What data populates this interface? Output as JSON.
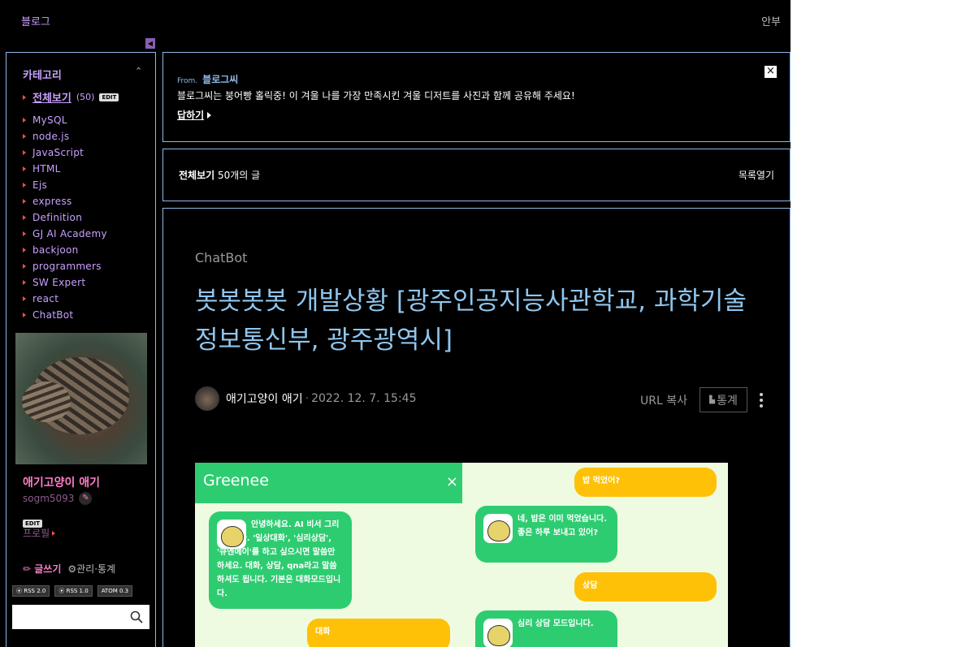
{
  "topbar": {
    "blog_title": "블로그",
    "right_label": "안부"
  },
  "sidebar": {
    "category_header": "카테고리",
    "category_toggle": "⌃",
    "all": {
      "label": "전체보기",
      "count": "(50)",
      "edit": "EDIT"
    },
    "categories": [
      "MySQL",
      "node.js",
      "JavaScript",
      "HTML",
      "Ejs",
      "express",
      "Definition",
      "GJ AI Academy",
      "backjoon",
      "programmers",
      "SW Expert",
      "react",
      "ChatBot"
    ],
    "profile": {
      "name": "애기고양이 애기",
      "id": "sogm5093",
      "edit": "EDIT",
      "link": "프로필"
    },
    "write_label": "글쓰기",
    "admin_label": "관리·통계",
    "rss": [
      "RSS 2.0",
      "RSS 1.0",
      "ATOM 0.3"
    ]
  },
  "notice": {
    "from_prefix": "From.",
    "from_source": "블로그씨",
    "text": "블로그씨는 붕어빵 홀릭중! 이 겨울 나를 가장 만족시킨 겨울 디저트를 사진과 함께 공유해 주세요!",
    "reply": "답하기",
    "close": "×"
  },
  "listbar": {
    "title": "전체보기",
    "count_text": "50개의 글",
    "open": "목록열기"
  },
  "article": {
    "category": "ChatBot",
    "title": "봇봇봇봇 개발상황 [광주인공지능사관학교, 과학기술정보통신부, 광주광역시]",
    "author": "애기고양이 애기",
    "date": "2022. 12. 7. 15:45",
    "url_copy": "URL 복사",
    "stats": "통계"
  },
  "chat_image": {
    "bot_name": "Greenee",
    "close": "×",
    "messages": [
      {
        "from": "bot",
        "text": "안녕하세요. AI 비서 그리니입니다. '일상대화', '심리상담', '큐엔에이'를 하고 싶으시면 말씀만 하세요. 대화, 상담, qna라고 말씀하셔도 됩니다. 기본은 대화모드입니다."
      },
      {
        "from": "user",
        "text": "대화"
      },
      {
        "from": "user",
        "text": "밥 먹었어?"
      },
      {
        "from": "bot",
        "text": "네, 밥은 이미 먹었습니다. 좋은 하루 보내고 있어?"
      },
      {
        "from": "user",
        "text": "상담"
      },
      {
        "from": "bot",
        "text": "심리 상담 모드입니다."
      }
    ]
  },
  "colors": {
    "background": "#000000",
    "accent": "#c9a0ff",
    "title": "#8fc6ee",
    "border": "#8fb8e8",
    "chat_green": "#2ecc71",
    "chat_yellow": "#ffc107"
  }
}
